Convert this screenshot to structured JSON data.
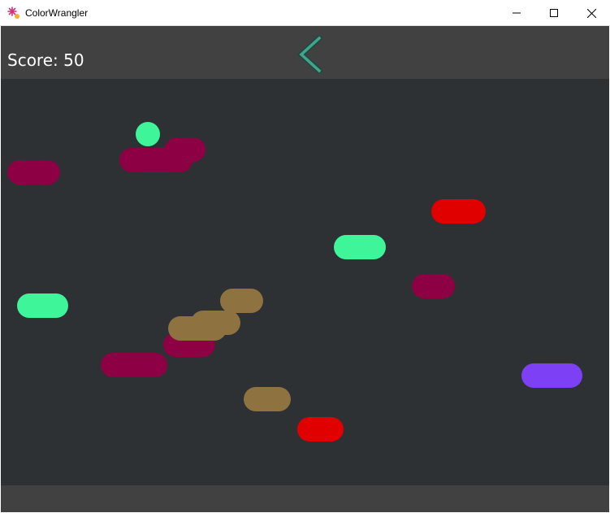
{
  "window": {
    "title": "ColorWrangler",
    "icons": {
      "app": "app-star-icon",
      "minimize": "minimize-icon",
      "maximize": "maximize-icon",
      "close": "close-icon"
    }
  },
  "hud": {
    "score_text": "Score: 50",
    "back_icon": "chevron-left-icon",
    "back_color": "#3fa58c"
  },
  "colors": {
    "background": "#2e3133",
    "bars": "#414141",
    "ball": "#3ef59a"
  },
  "game": {
    "ball": {
      "color": "#3ef59a"
    },
    "pills": [
      {
        "color": "#8e0044"
      },
      {
        "color": "#8e0044"
      },
      {
        "color": "#8e0044"
      },
      {
        "color": "#e00000"
      },
      {
        "color": "#3ef59a"
      },
      {
        "color": "#8e0044"
      },
      {
        "color": "#3ef59a"
      },
      {
        "color": "#8e7240"
      },
      {
        "color": "#8e0044"
      },
      {
        "color": "#8e7240"
      },
      {
        "color": "#8e7240"
      },
      {
        "color": "#8e0044"
      },
      {
        "color": "#7d40f5"
      },
      {
        "color": "#8e7240"
      },
      {
        "color": "#e00000"
      }
    ]
  }
}
